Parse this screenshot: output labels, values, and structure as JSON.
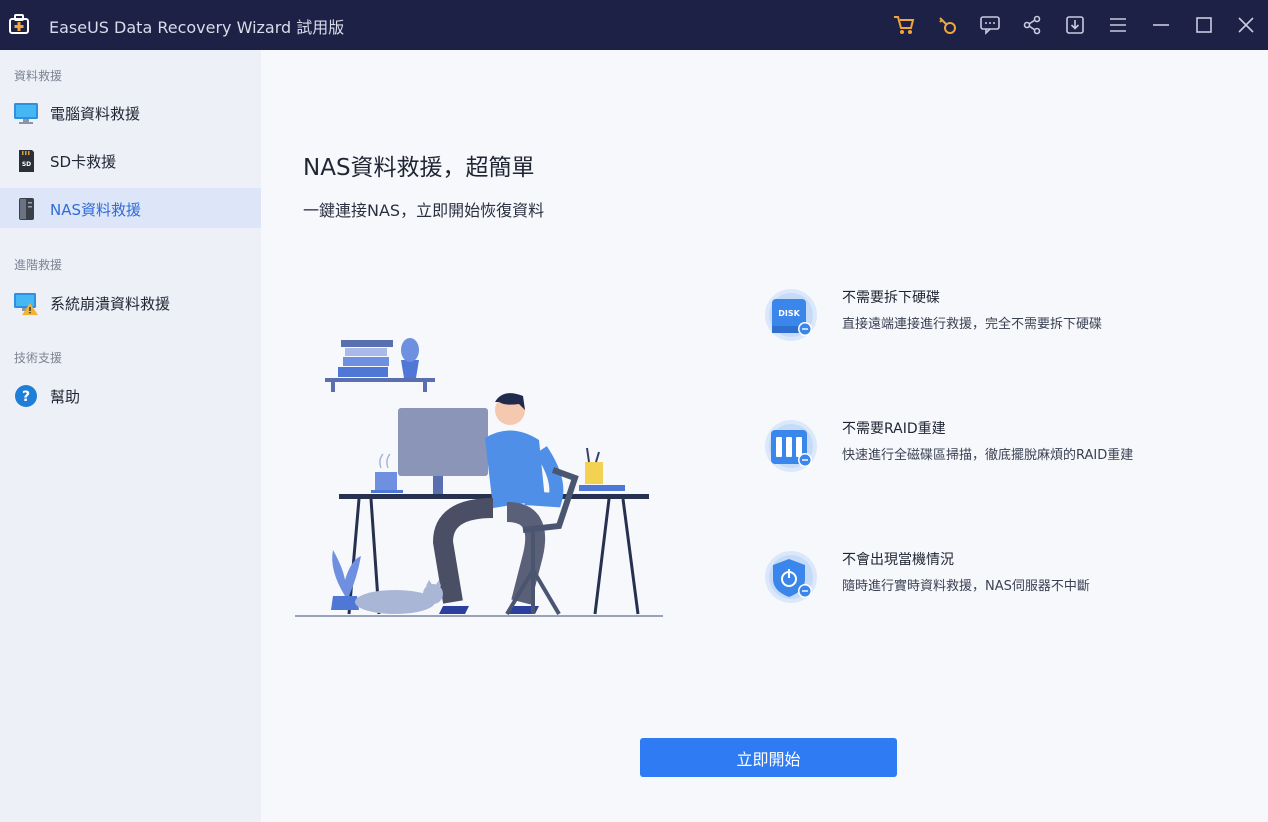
{
  "app": {
    "title": "EaseUS Data Recovery Wizard 試用版"
  },
  "titlebar": {
    "buttons": [
      {
        "name": "cart-icon",
        "color": "#f0a63b"
      },
      {
        "name": "key-icon",
        "color": "#f0a63b"
      },
      {
        "name": "feedback-icon",
        "color": "#c8cbe0"
      },
      {
        "name": "share-icon",
        "color": "#c8cbe0"
      },
      {
        "name": "update-icon",
        "color": "#c8cbe0"
      },
      {
        "name": "menu-icon",
        "color": "#c8cbe0"
      },
      {
        "name": "minimize-icon",
        "color": "#c8cbe0"
      },
      {
        "name": "maximize-icon",
        "color": "#c8cbe0"
      },
      {
        "name": "close-icon",
        "color": "#c8cbe0"
      }
    ]
  },
  "sidebar": {
    "sections": [
      {
        "label": "資料救援"
      },
      {
        "label": "進階救援"
      },
      {
        "label": "技術支援"
      }
    ],
    "items": [
      {
        "label": "電腦資料救援",
        "icon": "monitor-icon"
      },
      {
        "label": "SD卡救援",
        "icon": "sd-card-icon"
      },
      {
        "label": "NAS資料救援",
        "icon": "nas-icon",
        "active": true
      },
      {
        "label": "系統崩潰資料救援",
        "icon": "system-crash-icon"
      },
      {
        "label": "幫助",
        "icon": "help-icon"
      }
    ]
  },
  "main": {
    "headline": "NAS資料救援，超簡單",
    "subline": "一鍵連接NAS，立即開始恢復資料",
    "features": [
      {
        "title": "不需要拆下硬碟",
        "desc": "直接遠端連接進行救援，完全不需要拆下硬碟",
        "icon": "disk-icon",
        "icon_text": "DISK"
      },
      {
        "title": "不需要RAID重建",
        "desc": "快速進行全磁碟區掃描，徹底擺脫麻煩的RAID重建",
        "icon": "raid-icon"
      },
      {
        "title": "不會出現當機情況",
        "desc": "隨時進行實時資料救援，NAS伺服器不中斷",
        "icon": "shield-power-icon"
      }
    ],
    "start_button": "立即開始"
  },
  "colors": {
    "titlebar_bg": "#1c2145",
    "sidebar_bg": "#edf0f6",
    "active_item_bg": "#dde6f8",
    "accent": "#2f7bf4"
  }
}
